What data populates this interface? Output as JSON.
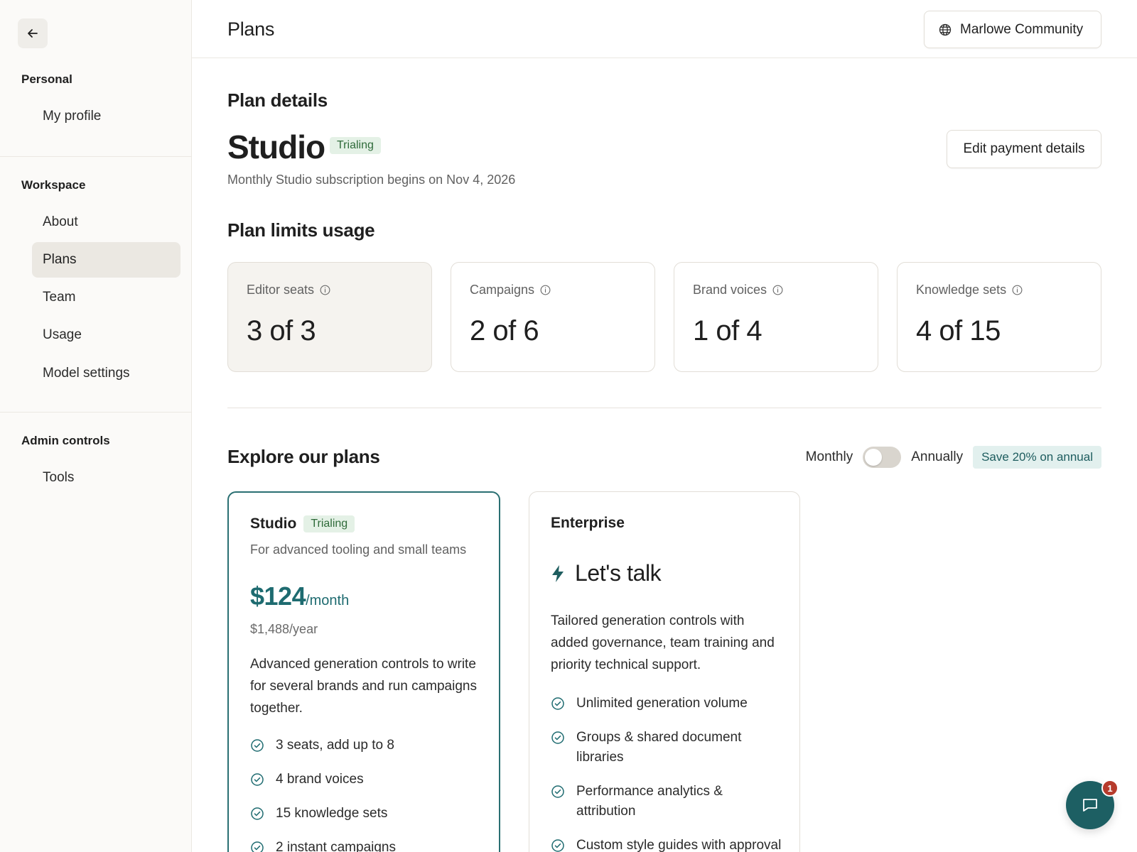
{
  "sidebar": {
    "back_icon": "arrow-left-icon",
    "sections": [
      {
        "heading": "Personal",
        "items": [
          {
            "label": "My profile",
            "active": false
          }
        ]
      },
      {
        "heading": "Workspace",
        "items": [
          {
            "label": "About",
            "active": false
          },
          {
            "label": "Plans",
            "active": true
          },
          {
            "label": "Team",
            "active": false
          },
          {
            "label": "Usage",
            "active": false
          },
          {
            "label": "Model settings",
            "active": false
          }
        ]
      },
      {
        "heading": "Admin controls",
        "items": [
          {
            "label": "Tools",
            "active": false
          }
        ]
      }
    ]
  },
  "header": {
    "title": "Plans",
    "workspace_label": "Marlowe Community",
    "workspace_icon": "globe-icon"
  },
  "plan_details": {
    "heading": "Plan details",
    "plan_name": "Studio",
    "status_badge": "Trialing",
    "subtitle": "Monthly Studio subscription begins on Nov 4, 2026",
    "edit_payment_label": "Edit payment details"
  },
  "limits": {
    "heading": "Plan limits usage",
    "cards": [
      {
        "label": "Editor seats",
        "value": "3 of 3",
        "full": true
      },
      {
        "label": "Campaigns",
        "value": "2 of 6",
        "full": false
      },
      {
        "label": "Brand voices",
        "value": "1 of 4",
        "full": false
      },
      {
        "label": "Knowledge sets",
        "value": "4 of 15",
        "full": false
      }
    ]
  },
  "explore": {
    "heading": "Explore our plans",
    "monthly_label": "Monthly",
    "annually_label": "Annually",
    "toggle_annual": false,
    "save_badge": "Save 20% on annual",
    "plans": {
      "studio": {
        "name": "Studio",
        "badge": "Trialing",
        "tagline": "For advanced tooling and small teams",
        "price": "$124",
        "per": "/month",
        "yearly": "$1,488/year",
        "description": "Advanced generation controls to write for several brands and run campaigns together.",
        "features": [
          "3 seats, add up to 8",
          "4 brand voices",
          "15 knowledge sets",
          "2 instant campaigns"
        ]
      },
      "enterprise": {
        "name": "Enterprise",
        "cta": "Let's talk",
        "cta_icon": "lightning-icon",
        "description": "Tailored generation controls with added governance, team training and priority technical support.",
        "features": [
          "Unlimited generation volume",
          "Groups & shared document libraries",
          "Performance analytics & attribution",
          "Custom style guides with approval"
        ]
      }
    }
  },
  "chat": {
    "icon": "chat-bubble-icon",
    "unread": "1"
  },
  "colors": {
    "accent": "#1e6b70",
    "badge_green": "#2f6b3a",
    "alert": "#b63b2c"
  }
}
